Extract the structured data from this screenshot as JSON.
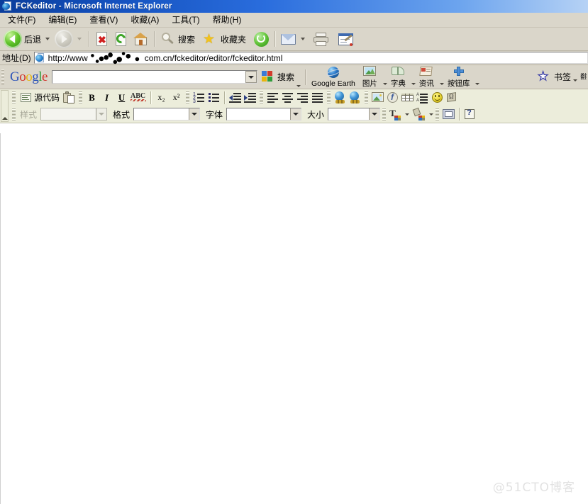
{
  "window": {
    "title": "FCKeditor - Microsoft Internet Explorer",
    "icon": "ie-page-icon"
  },
  "menubar": {
    "items": [
      {
        "label": "文件(F)",
        "name": "menu-file"
      },
      {
        "label": "编辑(E)",
        "name": "menu-edit"
      },
      {
        "label": "查看(V)",
        "name": "menu-view"
      },
      {
        "label": "收藏(A)",
        "name": "menu-favorites"
      },
      {
        "label": "工具(T)",
        "name": "menu-tools"
      },
      {
        "label": "帮助(H)",
        "name": "menu-help"
      }
    ]
  },
  "navbar": {
    "back_label": "后退",
    "search_label": "搜索",
    "favorites_label": "收藏夹",
    "icons": {
      "back": "back-arrow-icon",
      "forward": "forward-arrow-icon",
      "stop": "stop-icon",
      "refresh": "refresh-icon",
      "home": "home-icon",
      "search": "search-icon",
      "favorites": "star-icon",
      "history": "history-icon",
      "mail": "mail-icon",
      "print": "print-icon",
      "edit": "edit-page-icon"
    }
  },
  "address": {
    "label": "地址(D)",
    "url_prefix": "http://www",
    "url_suffix": "com.cn/fckeditor/editor/fckeditor.html",
    "redacted": true
  },
  "google_toolbar": {
    "logo": "Google",
    "search_value": "",
    "search_button": "搜索",
    "buttons": [
      {
        "label": "Google Earth",
        "icon": "google-earth-icon",
        "caret": false
      },
      {
        "label": "图片",
        "icon": "images-icon",
        "caret": true
      },
      {
        "label": "字典",
        "icon": "dictionary-icon",
        "caret": true
      },
      {
        "label": "资讯",
        "icon": "news-icon",
        "caret": true
      },
      {
        "label": "按钮库",
        "icon": "button-gallery-icon",
        "caret": true
      }
    ],
    "bookmarks_label": "书签",
    "translate_label": "翻"
  },
  "editor": {
    "toolbar_row1": [
      {
        "name": "source-button",
        "label": "源代码",
        "icon": "source-icon"
      },
      {
        "name": "paste-button",
        "label": "",
        "icon": "paste-icon"
      },
      {
        "name": "bold-button",
        "label": "B",
        "icon": "bold-icon"
      },
      {
        "name": "italic-button",
        "label": "I",
        "icon": "italic-icon"
      },
      {
        "name": "underline-button",
        "label": "U",
        "icon": "underline-icon"
      },
      {
        "name": "strikethrough-button",
        "label": "ABC",
        "icon": "strikethrough-icon"
      },
      {
        "name": "subscript-button",
        "label": "x₂",
        "icon": "subscript-icon"
      },
      {
        "name": "superscript-button",
        "label": "x²",
        "icon": "superscript-icon"
      },
      {
        "name": "numbered-list-button",
        "label": "",
        "icon": "numbered-list-icon"
      },
      {
        "name": "bulleted-list-button",
        "label": "",
        "icon": "bulleted-list-icon"
      },
      {
        "name": "outdent-button",
        "label": "",
        "icon": "outdent-icon"
      },
      {
        "name": "indent-button",
        "label": "",
        "icon": "indent-icon"
      },
      {
        "name": "align-left-button",
        "label": "",
        "icon": "align-left-icon"
      },
      {
        "name": "align-center-button",
        "label": "",
        "icon": "align-center-icon"
      },
      {
        "name": "align-right-button",
        "label": "",
        "icon": "align-right-icon"
      },
      {
        "name": "align-justify-button",
        "label": "",
        "icon": "align-justify-icon"
      },
      {
        "name": "insert-link-button",
        "label": "",
        "icon": "link-icon"
      },
      {
        "name": "unlink-button",
        "label": "",
        "icon": "unlink-icon"
      },
      {
        "name": "insert-image-button",
        "label": "",
        "icon": "image-icon"
      },
      {
        "name": "insert-flash-button",
        "label": "",
        "icon": "flash-icon"
      },
      {
        "name": "insert-table-button",
        "label": "",
        "icon": "table-icon"
      },
      {
        "name": "horizontal-rule-button",
        "label": "",
        "icon": "horizontal-rule-icon"
      },
      {
        "name": "smiley-button",
        "label": "",
        "icon": "smiley-icon"
      },
      {
        "name": "special-char-button",
        "label": "",
        "icon": "special-char-icon"
      }
    ],
    "style_label": "样式",
    "style_value": "",
    "format_label": "格式",
    "format_value": "",
    "font_label": "字体",
    "font_value": "",
    "size_label": "大小",
    "size_value": "",
    "textcolor_icon": "text-color-icon",
    "bgcolor_icon": "background-color-icon",
    "showblocks_icon": "show-blocks-icon",
    "about_icon": "about-help-icon",
    "content": ""
  },
  "watermark": {
    "text": "@51CTO博客"
  },
  "colors": {
    "titlebar_start": "#0b3e9c",
    "titlebar_end": "#b6d2f5",
    "chrome": "#dad6ca",
    "editor_toolbar": "#eceddb",
    "editor_body": "#ffffff",
    "watermark": "#e2e2e2"
  }
}
